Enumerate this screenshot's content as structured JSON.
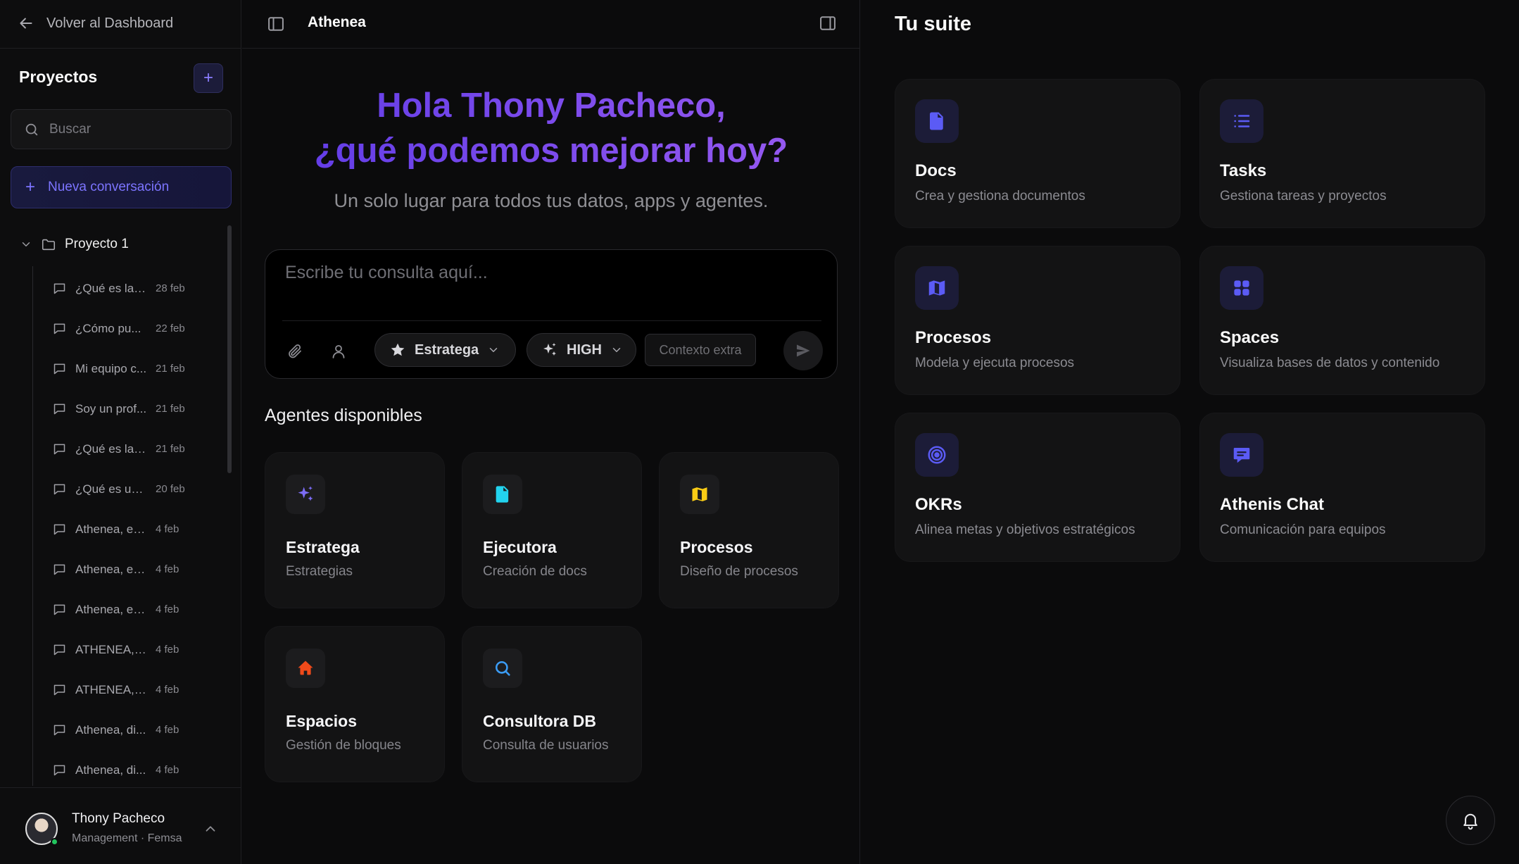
{
  "sidebar": {
    "back_label": "Volver al Dashboard",
    "projects_title": "Proyectos",
    "add_label": "+",
    "search_placeholder": "Buscar",
    "new_conversation_label": "Nueva conversación",
    "folder_name": "Proyecto 1",
    "conversations": [
      {
        "title": "¿Qué es la ...",
        "date": "28 feb"
      },
      {
        "title": "¿Cómo pu...",
        "date": "22 feb"
      },
      {
        "title": "Mi equipo c...",
        "date": "21 feb"
      },
      {
        "title": "Soy un prof...",
        "date": "21 feb"
      },
      {
        "title": "¿Qué es la ...",
        "date": "21 feb"
      },
      {
        "title": "¿Qué es un...",
        "date": "20 feb"
      },
      {
        "title": "Athenea, ex...",
        "date": "4 feb"
      },
      {
        "title": "Athenea, ex...",
        "date": "4 feb"
      },
      {
        "title": "Athenea, ex...",
        "date": "4 feb"
      },
      {
        "title": "ATHENEA, a...",
        "date": "4 feb"
      },
      {
        "title": "ATHENEA, a...",
        "date": "4 feb"
      },
      {
        "title": "Athenea, di...",
        "date": "4 feb"
      },
      {
        "title": "Athenea, di...",
        "date": "4 feb"
      }
    ],
    "user": {
      "name": "Thony Pacheco",
      "role": "Management · Femsa"
    }
  },
  "main": {
    "title": "Athenea",
    "greeting_line1": "Hola Thony Pacheco,",
    "greeting_line2": "¿qué podemos mejorar hoy?",
    "subtitle": "Un solo lugar para todos tus datos, apps y agentes.",
    "composer": {
      "placeholder": "Escribe tu consulta aquí...",
      "agent_select": "Estratega",
      "level_select": "HIGH",
      "context_label": "Contexto extra"
    },
    "agents_title": "Agentes disponibles",
    "agents": [
      {
        "name": "Estratega",
        "desc": "Estrategias",
        "icon": "sparkles-icon",
        "color": "#7c6cf5"
      },
      {
        "name": "Ejecutora",
        "desc": "Creación de docs",
        "icon": "document-icon",
        "color": "#22d3ee"
      },
      {
        "name": "Procesos",
        "desc": "Diseño de procesos",
        "icon": "map-icon",
        "color": "#facc15"
      },
      {
        "name": "Espacios",
        "desc": "Gestión de bloques",
        "icon": "home-icon",
        "color": "#f04a1a"
      },
      {
        "name": "Consultora DB",
        "desc": "Consulta de usuarios",
        "icon": "search-icon",
        "color": "#3b9cf5"
      }
    ]
  },
  "suite": {
    "title": "Tu suite",
    "apps": [
      {
        "name": "Docs",
        "desc": "Crea y gestiona documentos",
        "icon": "document-icon"
      },
      {
        "name": "Tasks",
        "desc": "Gestiona tareas y proyectos",
        "icon": "list-icon"
      },
      {
        "name": "Procesos",
        "desc": "Modela y ejecuta procesos",
        "icon": "map-icon"
      },
      {
        "name": "Spaces",
        "desc": "Visualiza bases de datos y contenido",
        "icon": "grid-icon"
      },
      {
        "name": "OKRs",
        "desc": "Alinea metas y objetivos estratégicos",
        "icon": "target-icon"
      },
      {
        "name": "Athenis Chat",
        "desc": "Comunicación para equipos",
        "icon": "chat-icon"
      }
    ],
    "accent": "#5b5bf5"
  }
}
